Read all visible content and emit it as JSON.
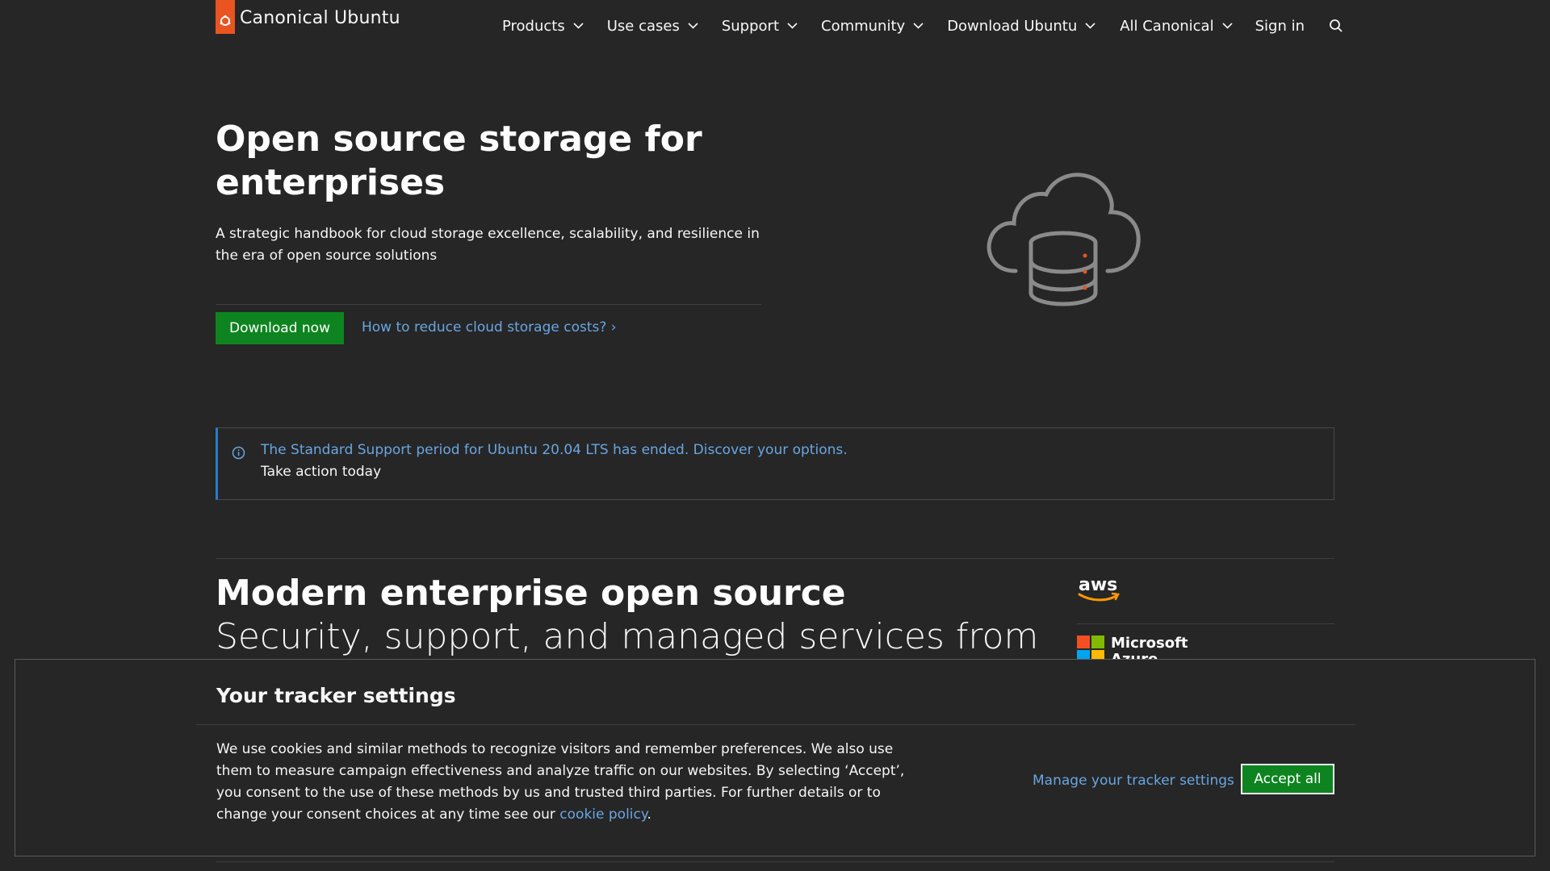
{
  "nav": {
    "brand": "Canonical Ubuntu",
    "items": [
      {
        "label": "Products"
      },
      {
        "label": "Use cases"
      },
      {
        "label": "Support"
      },
      {
        "label": "Community"
      },
      {
        "label": "Download Ubuntu"
      }
    ],
    "all_canonical": "All Canonical",
    "sign_in": "Sign in"
  },
  "hero": {
    "title": "Open source storage for enterprises",
    "subtitle": "A strategic handbook for cloud storage excellence, scalability, and resilience in the era of open source solutions",
    "cta": "Download now",
    "link": "How to reduce cloud storage costs? ›"
  },
  "notice": {
    "title": "The Standard Support period for Ubuntu 20.04 LTS has ended. Discover your options.",
    "body": "Take action today"
  },
  "section": {
    "title": "Modern enterprise open source",
    "subtitle": "Security, support, and managed services from",
    "partners": {
      "aws": "aws",
      "microsoft_line1": "Microsoft",
      "microsoft_line2": "Azure"
    }
  },
  "cookie": {
    "title": "Your tracker settings",
    "text": "We use cookies and similar methods to recognize visitors and remember preferences. We also use them to measure campaign effectiveness and analyze traffic on our websites. By selecting ‘Accept’, you consent to the use of these methods by us and trusted third parties. For further details or to change your consent choices at any time see our ",
    "policy_link": "cookie policy",
    "text_end": ".",
    "manage": "Manage your tracker settings",
    "accept": "Accept all"
  },
  "colors": {
    "background": "#262626",
    "accent_orange": "#e95420",
    "button_green": "#0e8420",
    "link_blue": "#69a6e2",
    "notice_border": "#2c7ac9"
  },
  "icons": [
    "ubuntu-logo-icon",
    "chevron-down-icon",
    "search-icon",
    "info-icon",
    "cloud-database-icon",
    "microsoft-logo-icon",
    "aws-smile-icon"
  ]
}
